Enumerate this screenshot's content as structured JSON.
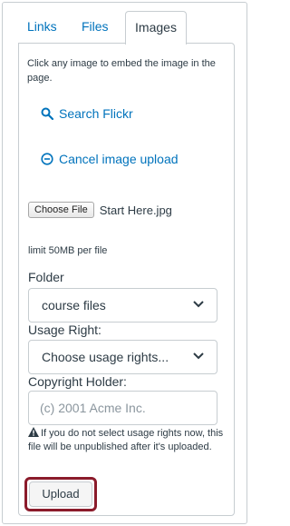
{
  "tabs": [
    {
      "label": "Links"
    },
    {
      "label": "Files"
    },
    {
      "label": "Images"
    }
  ],
  "active_tab": "Images",
  "intro_text": "Click any image to embed the image in the page.",
  "actions": {
    "search_flickr": "Search Flickr",
    "cancel_upload": "Cancel image upload"
  },
  "file": {
    "button_label": "Choose File",
    "selected_name": "Start Here.jpg",
    "limit_text": "limit 50MB per file"
  },
  "folder": {
    "label": "Folder",
    "selected": "course files"
  },
  "usage_right": {
    "label": "Usage Right:",
    "selected": "Choose usage rights..."
  },
  "copyright": {
    "label": "Copyright Holder:",
    "placeholder": "(c) 2001 Acme Inc."
  },
  "warning_text": "If you do not select usage rights now, this file will be unpublished after it's uploaded.",
  "upload_label": "Upload",
  "colors": {
    "link": "#0073bc",
    "text": "#2d3b45",
    "border": "#c7cdd1",
    "highlight": "#8b1b2b"
  }
}
